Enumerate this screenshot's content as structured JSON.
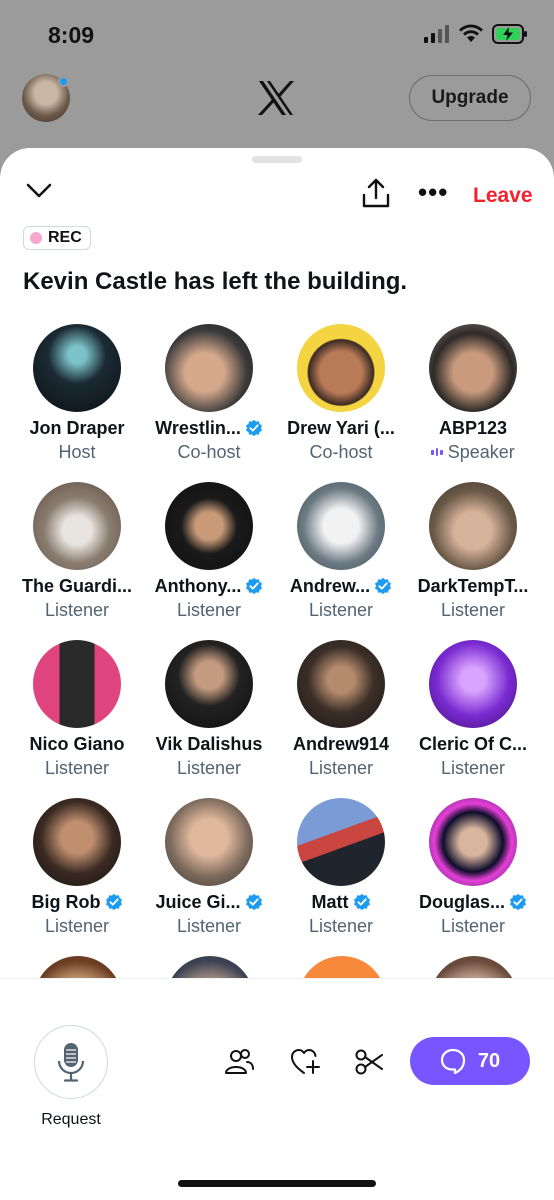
{
  "status": {
    "time": "8:09"
  },
  "header": {
    "upgrade_label": "Upgrade"
  },
  "space": {
    "leave_label": "Leave",
    "rec_label": "REC",
    "title": "Kevin Castle has left the building."
  },
  "participants": [
    {
      "name": "Jon Draper",
      "role": "Host",
      "verified": false
    },
    {
      "name": "Wrestlin...",
      "role": "Co-host",
      "verified": true
    },
    {
      "name": "Drew Yari (...",
      "role": "Co-host",
      "verified": false
    },
    {
      "name": "ABP123",
      "role": "Speaker",
      "verified": false,
      "speaking": true
    },
    {
      "name": "The Guardi...",
      "role": "Listener",
      "verified": false
    },
    {
      "name": "Anthony...",
      "role": "Listener",
      "verified": true
    },
    {
      "name": "Andrew...",
      "role": "Listener",
      "verified": true
    },
    {
      "name": "DarkTempT...",
      "role": "Listener",
      "verified": false
    },
    {
      "name": "Nico Giano",
      "role": "Listener",
      "verified": false
    },
    {
      "name": "Vik Dalishus",
      "role": "Listener",
      "verified": false
    },
    {
      "name": "Andrew914",
      "role": "Listener",
      "verified": false
    },
    {
      "name": "Cleric Of C...",
      "role": "Listener",
      "verified": false
    },
    {
      "name": "Big Rob",
      "role": "Listener",
      "verified": true
    },
    {
      "name": "Juice Gi...",
      "role": "Listener",
      "verified": true
    },
    {
      "name": "Matt",
      "role": "Listener",
      "verified": true
    },
    {
      "name": "Douglas...",
      "role": "Listener",
      "verified": true
    }
  ],
  "bottom": {
    "request_label": "Request",
    "comment_count": "70"
  },
  "colors": {
    "accent": "#7856ff",
    "leave": "#f4212e",
    "verified": "#1d9bf0",
    "rec_dot": "#f7a8d0"
  }
}
